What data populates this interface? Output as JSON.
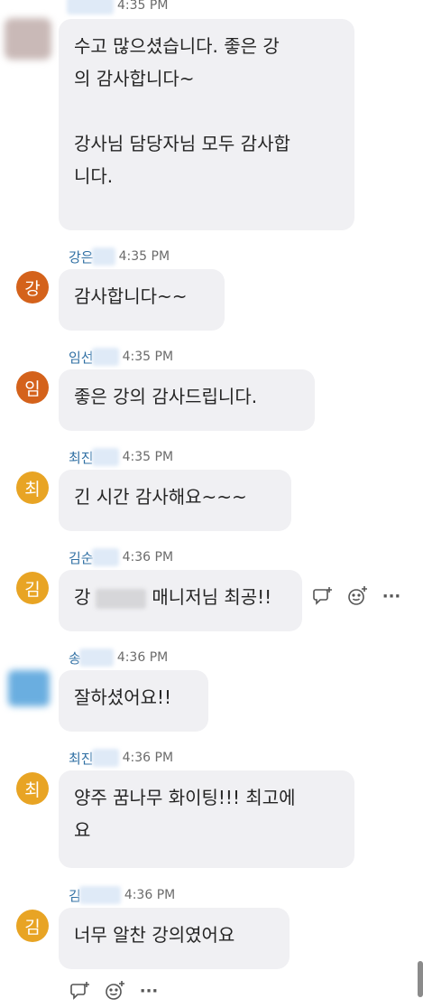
{
  "colors": {
    "orange_avatar": "#d4621b",
    "yellow_avatar": "#e8a424",
    "bubble": "#f0f0f3",
    "name": "#2f6fa3"
  },
  "messages": [
    {
      "name": "",
      "time": "4:35 PM",
      "lines": [
        "수고 많으셨습니다. 좋은 강",
        "의 감사합니다~",
        "",
        "강사님 담당자님 모두 감사합",
        "니다."
      ]
    },
    {
      "name": "강은",
      "time": "4:35 PM",
      "avatar": "강",
      "lines": [
        "감사합니다~~"
      ]
    },
    {
      "name": "임선",
      "time": "4:35 PM",
      "avatar": "임",
      "lines": [
        "좋은 강의 감사드립니다."
      ]
    },
    {
      "name": "최진",
      "time": "4:35 PM",
      "avatar": "최",
      "lines": [
        "긴 시간 감사해요~~~"
      ]
    },
    {
      "name": "김순",
      "time": "4:36 PM",
      "avatar": "김",
      "text_before": "강",
      "text_after": "매니저님 최공!!"
    },
    {
      "name": "송",
      "time": "4:36 PM",
      "lines": [
        "잘하셨어요!!"
      ]
    },
    {
      "name": "최진",
      "time": "4:36 PM",
      "avatar": "최",
      "lines": [
        "양주 꿈나무 화이팅!!!  최고에",
        "요"
      ]
    },
    {
      "name": "김",
      "time": "4:36 PM",
      "avatar": "김",
      "lines": [
        "너무 알찬 강의였어요"
      ]
    }
  ],
  "actions": {
    "reply_icon": "reply-icon",
    "emoji_icon": "emoji-react-icon",
    "more_icon": "more-icon",
    "more_label": "···"
  }
}
